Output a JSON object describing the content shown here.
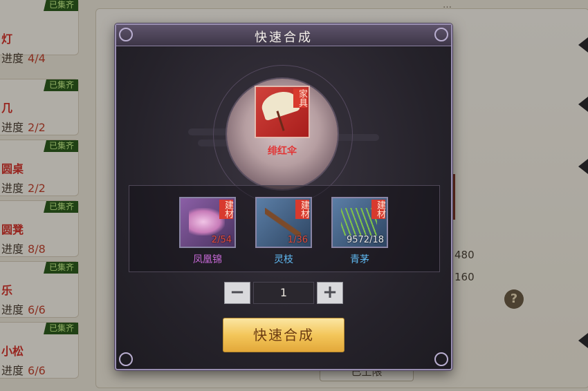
{
  "background": {
    "header_text": "…",
    "stat_values": [
      "480",
      "160"
    ],
    "help_label": "?",
    "bottom_button": "已上限"
  },
  "collection_list": [
    {
      "name": "灯",
      "badge": "已集齐",
      "progress_label": "进度",
      "progress": "4/4"
    },
    {
      "name": "几",
      "badge": "已集齐",
      "progress_label": "进度",
      "progress": "2/2"
    },
    {
      "name": "圆桌",
      "badge": "已集齐",
      "progress_label": "进度",
      "progress": "2/2"
    },
    {
      "name": "圆凳",
      "badge": "已集齐",
      "progress_label": "进度",
      "progress": "8/8"
    },
    {
      "name": "乐",
      "badge": "已集齐",
      "progress_label": "进度",
      "progress": "6/6"
    },
    {
      "name": "小松",
      "badge": "已集齐",
      "progress_label": "进度",
      "progress": "6/6"
    }
  ],
  "modal": {
    "title": "快速合成",
    "target": {
      "name": "绯红伞",
      "tag": "家具",
      "name_color": "#e23333"
    },
    "materials": [
      {
        "name": "凤凰锦",
        "tag": "建材",
        "count": "2/54",
        "name_color": "#c86ad8",
        "icon": "phoenix-silk-icon"
      },
      {
        "name": "灵枝",
        "tag": "建材",
        "count": "1/36",
        "name_color": "#5fb8f0",
        "icon": "spirit-branch-icon"
      },
      {
        "name": "青茅",
        "tag": "建材",
        "count": "9572/18",
        "name_color": "#5fb8f0",
        "icon": "green-grass-icon"
      }
    ],
    "quantity": {
      "minus_label": "−",
      "value": "1",
      "plus_label": "+"
    },
    "action_label": "快速合成"
  }
}
